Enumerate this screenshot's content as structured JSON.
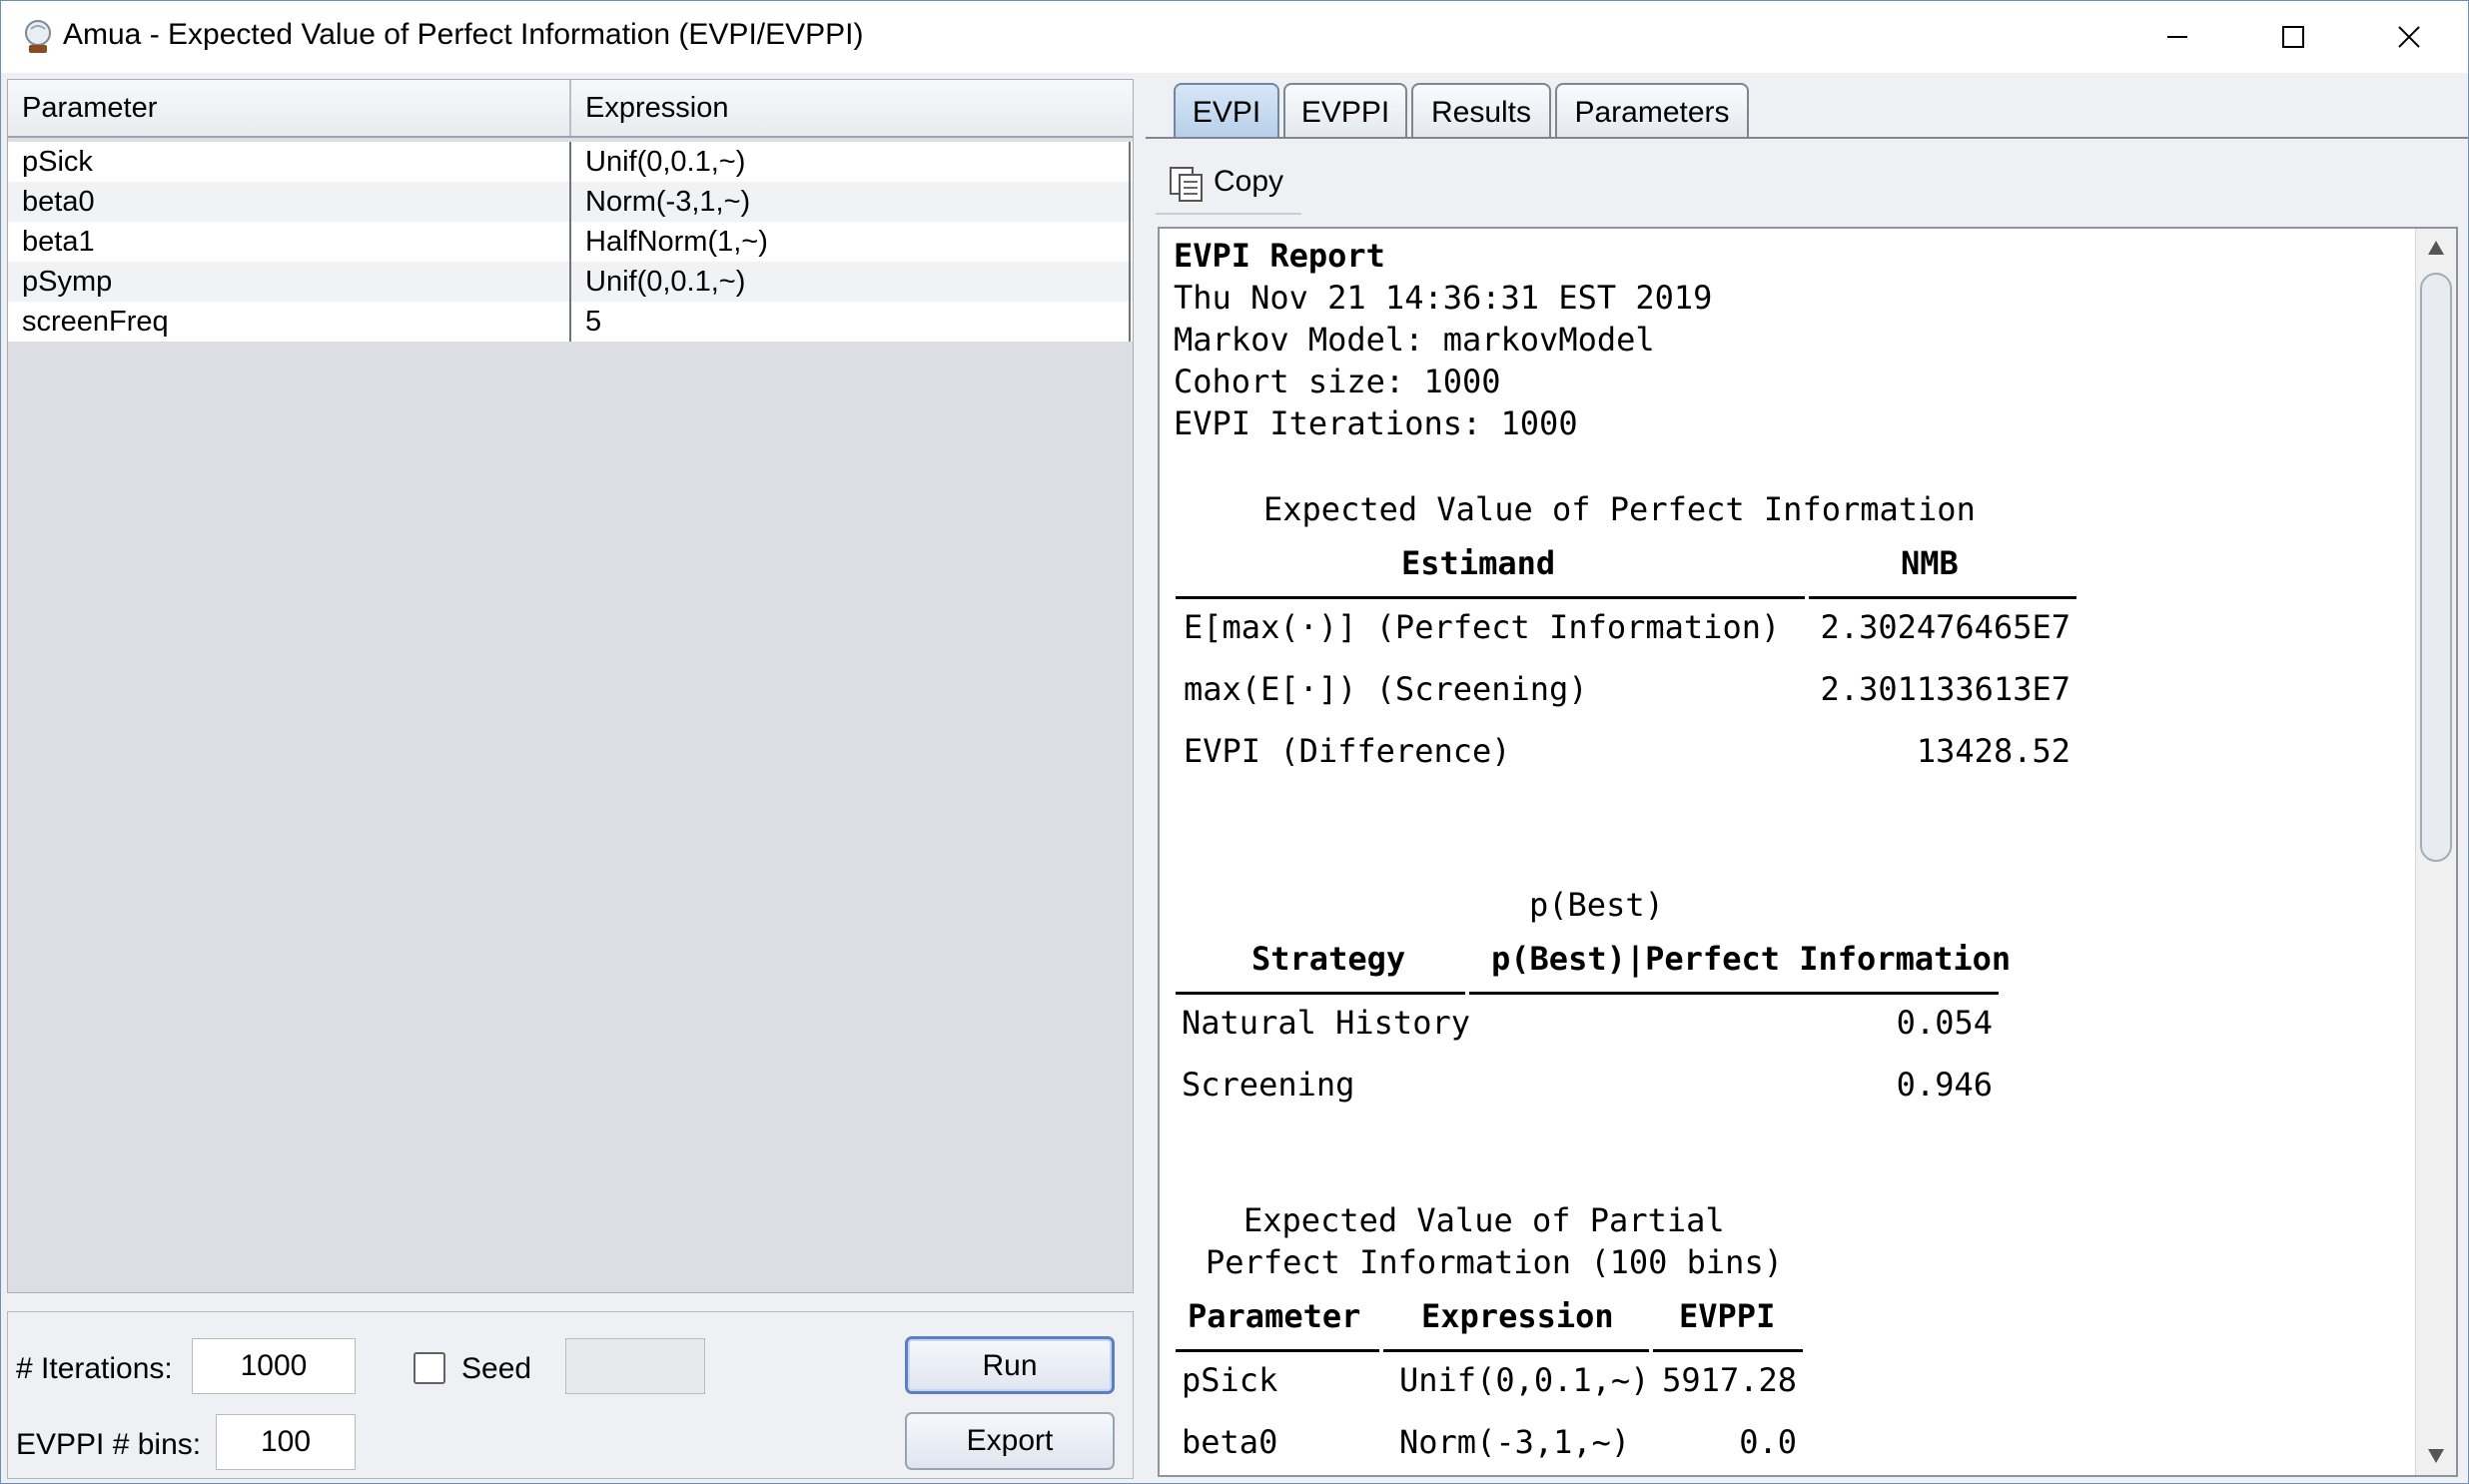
{
  "window": {
    "title": "Amua - Expected Value of Perfect Information (EVPI/EVPPI)",
    "controls": [
      "minimize-icon",
      "maximize-icon",
      "close-icon"
    ]
  },
  "param_table": {
    "headers": [
      "Parameter",
      "Expression"
    ],
    "rows": [
      {
        "name": "pSick",
        "expr": "Unif(0,0.1,~)"
      },
      {
        "name": "beta0",
        "expr": "Norm(-3,1,~)"
      },
      {
        "name": "beta1",
        "expr": "HalfNorm(1,~)"
      },
      {
        "name": "pSymp",
        "expr": "Unif(0,0.1,~)"
      },
      {
        "name": "screenFreq",
        "expr": "5"
      }
    ]
  },
  "controls": {
    "iterations_label": "# Iterations:",
    "iterations_value": "1000",
    "seed_label": "Seed",
    "seed_checked": false,
    "seed_value": "",
    "bins_label": "EVPPI # bins:",
    "bins_value": "100",
    "run_label": "Run",
    "export_label": "Export"
  },
  "tabs": [
    "EVPI",
    "EVPPI",
    "Results",
    "Parameters"
  ],
  "active_tab": "EVPI",
  "copy_label": "Copy",
  "report": {
    "heading": "EVPI Report",
    "date": "Thu Nov 21 14:36:31 EST 2019",
    "model": "Markov Model: markovModel",
    "cohort": "Cohort size: 1000",
    "iterations": "EVPI Iterations: 1000",
    "evpi_table": {
      "caption": "Expected Value of Perfect Information",
      "headers": [
        "Estimand",
        "NMB"
      ],
      "rows": [
        {
          "label": "E[max(·)] (Perfect Information)",
          "value": "2.302476465E7"
        },
        {
          "label": "max(E[·]) (Screening)",
          "value": "2.301133613E7"
        },
        {
          "label": "EVPI (Difference)",
          "value": "13428.52"
        }
      ]
    },
    "pbest_table": {
      "caption": "p(Best)",
      "headers": [
        "Strategy",
        "p(Best)|Perfect Information"
      ],
      "rows": [
        {
          "label": "Natural History",
          "value": "0.054"
        },
        {
          "label": "Screening",
          "value": "0.946"
        }
      ]
    },
    "evppi_table": {
      "caption_line1": "Expected Value of Partial",
      "caption_line2": "Perfect Information (100 bins)",
      "headers": [
        "Parameter",
        "Expression",
        "EVPPI"
      ],
      "rows": [
        {
          "param": "pSick",
          "expr": "Unif(0,0.1,~)",
          "value": "5917.28"
        },
        {
          "param": "beta0",
          "expr": "Norm(-3,1,~)",
          "value": "0.0"
        }
      ]
    }
  }
}
